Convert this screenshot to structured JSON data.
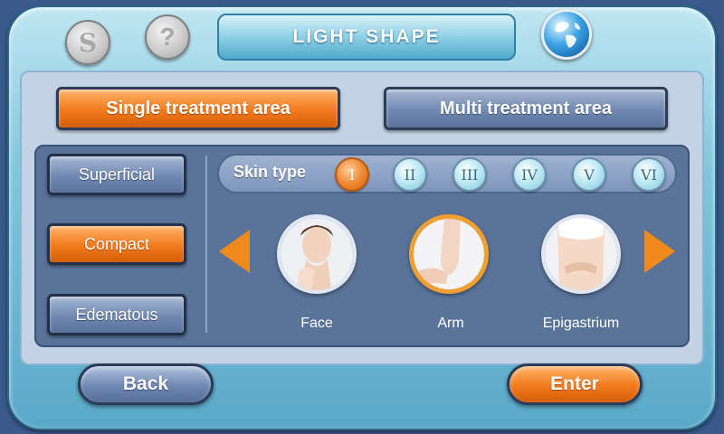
{
  "header": {
    "title": "LIGHT SHAPE",
    "s_button": "S",
    "help_button": "?"
  },
  "tabs": {
    "single": "Single treatment area",
    "multi": "Multi treatment area"
  },
  "depth_options": [
    "Superficial",
    "Compact",
    "Edematous"
  ],
  "skin_type": {
    "label": "Skin type",
    "options": [
      "I",
      "II",
      "III",
      "IV",
      "V",
      "VI"
    ]
  },
  "areas": [
    "Face",
    "Arm",
    "Epigastrium"
  ],
  "footer": {
    "back": "Back",
    "enter": "Enter"
  }
}
